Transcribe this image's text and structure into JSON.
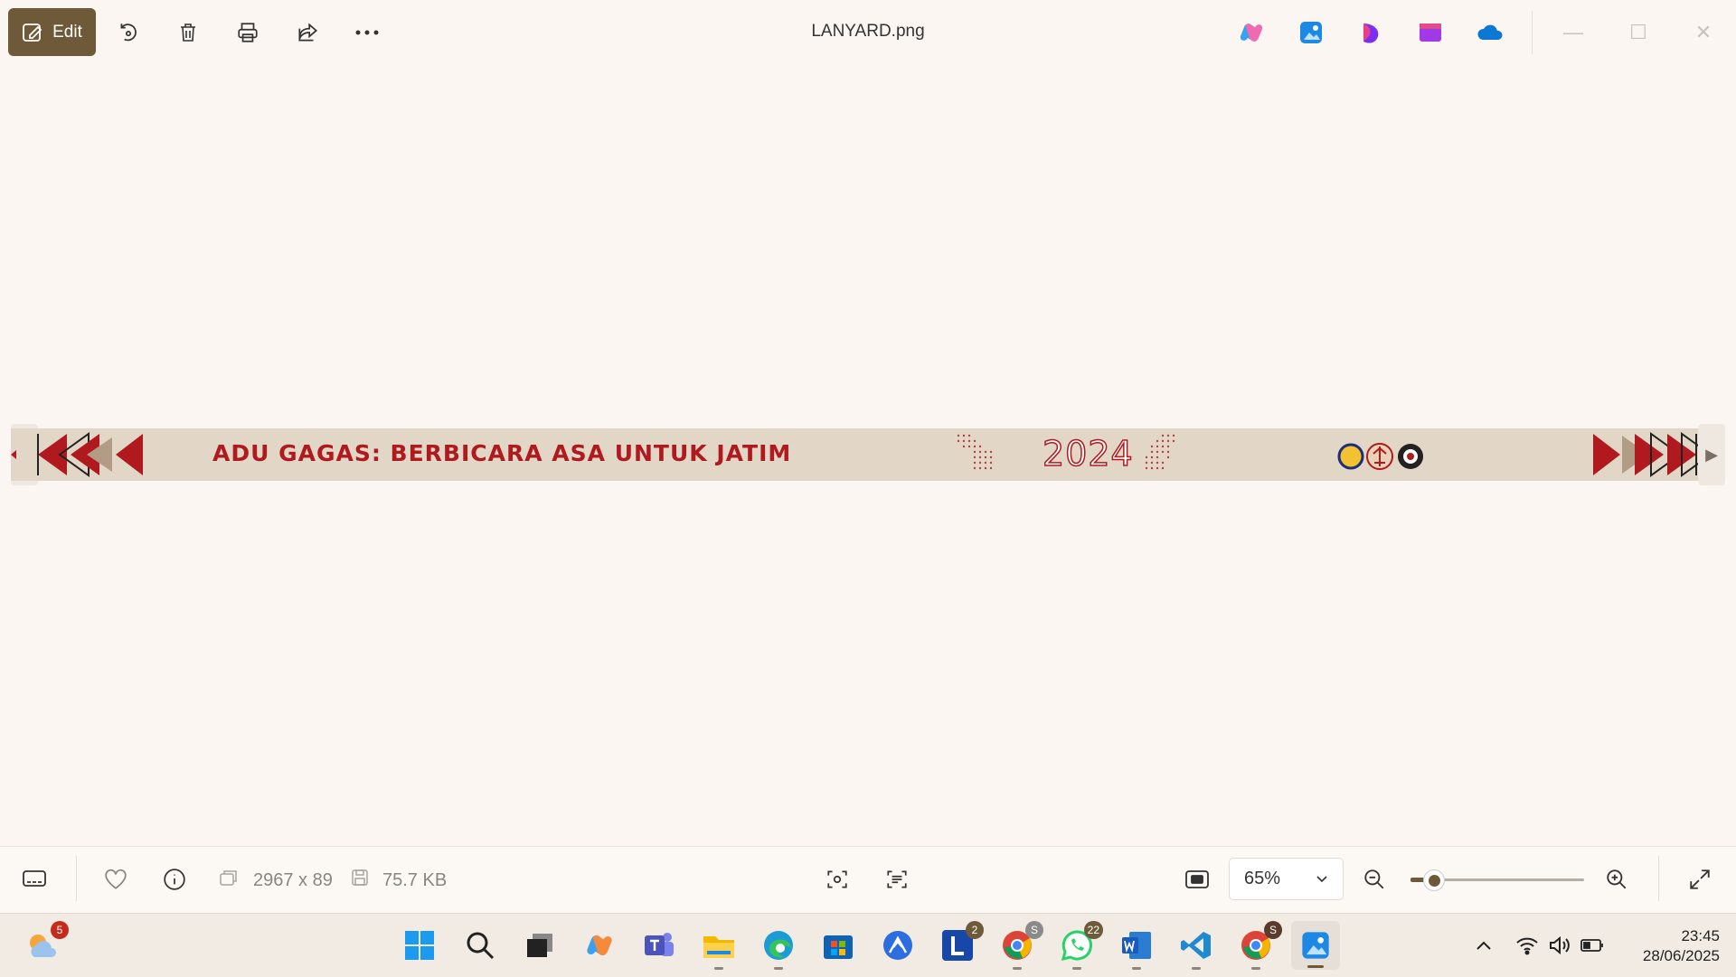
{
  "toolbar": {
    "edit_label": "Edit",
    "icons": [
      "rotate-icon",
      "delete-icon",
      "print-icon",
      "share-icon",
      "more-icon"
    ]
  },
  "window": {
    "title": "LANYARD.png",
    "apps": [
      "copilot-icon",
      "photos-icon",
      "clipchamp-icon",
      "designer-icon",
      "onedrive-icon"
    ],
    "controls": {
      "minimize": "—",
      "maximize": "☐",
      "close": "✕"
    }
  },
  "image": {
    "banner_text": "ADU GAGAS: BERBICARA ASA UNTUK JATIM",
    "year": "2024",
    "colors": {
      "background": "#e2d6c6",
      "accent": "#b01a1e"
    }
  },
  "bottombar": {
    "dimensions": "2967 x 89",
    "file_size": "75.7 KB",
    "zoom": "65%",
    "zoom_slider_level": 0.1
  },
  "taskbar": {
    "weather_badge": "5",
    "teams_badge": "",
    "l_badge": "2",
    "chrome_badge": "S",
    "whatsapp_badge": "22",
    "chrome2_badge": "S",
    "time": "23:45",
    "date": "28/06/2025"
  }
}
